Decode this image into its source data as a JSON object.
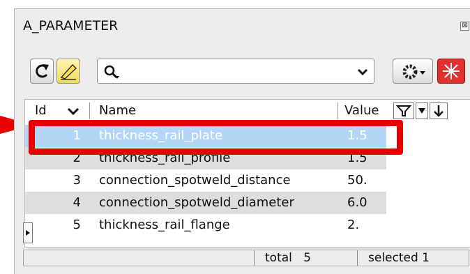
{
  "panel": {
    "title": "A_PARAMETER",
    "close_glyph": "⊠"
  },
  "toolbar": {
    "refresh_icon": "refresh-icon",
    "highlight_icon": "highlighter-icon",
    "search_icon": "search-icon",
    "search_value": "",
    "settings_icon": "gear-icon",
    "pick_icon": "pick-star-icon"
  },
  "table": {
    "columns": {
      "id": "Id",
      "name": "Name",
      "value": "Value"
    },
    "rows": [
      {
        "id": "1",
        "name": "thickness_rail_plate",
        "value": "1.5",
        "selected": true
      },
      {
        "id": "2",
        "name": "thickness_rail_profile",
        "value": "1.5",
        "selected": false
      },
      {
        "id": "3",
        "name": "connection_spotweld_distance",
        "value": "50.",
        "selected": false
      },
      {
        "id": "4",
        "name": "connection_spotweld_diameter",
        "value": "6.0",
        "selected": false
      },
      {
        "id": "5",
        "name": "thickness_rail_flange",
        "value": "2.",
        "selected": false
      }
    ]
  },
  "status": {
    "total": "total   5",
    "selected": "selected 1"
  },
  "colors": {
    "selection": "#b3d6f5",
    "alt_row": "#dedede",
    "annotation": "#e60000",
    "pick_button": "#e03030"
  }
}
